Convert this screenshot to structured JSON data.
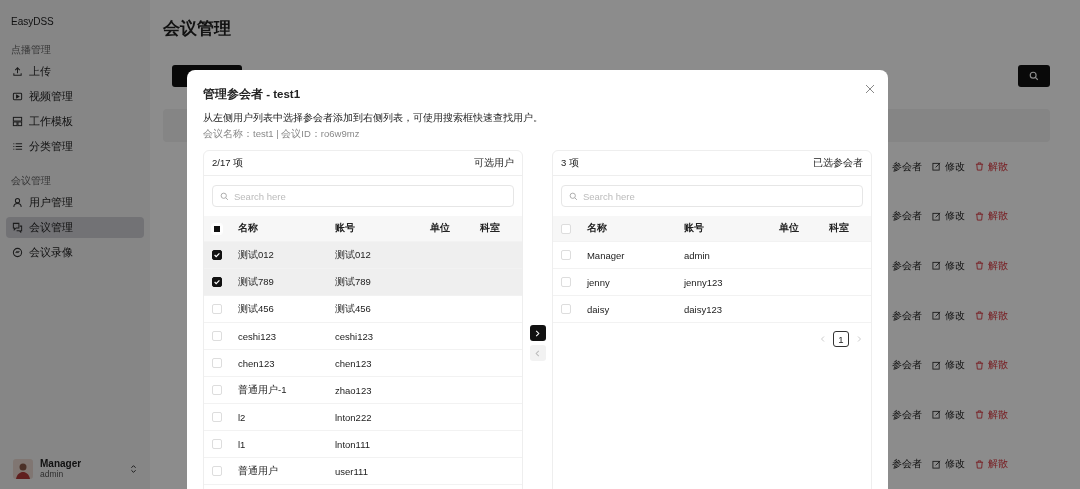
{
  "sidebar": {
    "logo": "EasyDSS",
    "sections": [
      {
        "label": "点播管理",
        "items": [
          {
            "label": "上传",
            "selected": false
          },
          {
            "label": "视频管理",
            "selected": false
          },
          {
            "label": "工作模板",
            "selected": false
          },
          {
            "label": "分类管理",
            "selected": false
          }
        ]
      },
      {
        "label": "会议管理",
        "items": [
          {
            "label": "用户管理",
            "selected": false
          },
          {
            "label": "会议管理",
            "selected": true
          },
          {
            "label": "会议录像",
            "selected": false
          }
        ]
      }
    ],
    "user": {
      "name": "Manager",
      "account": "admin"
    }
  },
  "page": {
    "title": "会议管理",
    "rows": [
      {
        "participants": "参会者",
        "edit": "修改",
        "dismiss": "解散"
      },
      {
        "participants": "参会者",
        "edit": "修改",
        "dismiss": "解散"
      },
      {
        "participants": "参会者",
        "edit": "修改",
        "dismiss": "解散"
      },
      {
        "participants": "参会者",
        "edit": "修改",
        "dismiss": "解散"
      },
      {
        "participants": "参会者",
        "edit": "修改",
        "dismiss": "解散"
      },
      {
        "participants": "参会者",
        "edit": "修改",
        "dismiss": "解散"
      },
      {
        "participants": "参会者",
        "edit": "修改",
        "dismiss": "解散"
      }
    ]
  },
  "dialog": {
    "title": "管理参会者 - test1",
    "description": "从左侧用户列表中选择参会者添加到右侧列表，可使用搜索框快速查找用户。",
    "meta": "会议名称：test1 | 会议ID：ro6w9mz",
    "panels": [
      {
        "count": "2/17 项",
        "caption": "可选用户",
        "search_placeholder": "Search here",
        "header_partial": true,
        "columns": [
          "名称",
          "账号",
          "单位",
          "科室"
        ],
        "rows": [
          {
            "name": "测试012",
            "account": "测试012",
            "checked": true
          },
          {
            "name": "测试789",
            "account": "测试789",
            "checked": true
          },
          {
            "name": "测试456",
            "account": "测试456",
            "checked": false
          },
          {
            "name": "ceshi123",
            "account": "ceshi123",
            "checked": false
          },
          {
            "name": "chen123",
            "account": "chen123",
            "checked": false
          },
          {
            "name": "普通用户-1",
            "account": "zhao123",
            "checked": false
          },
          {
            "name": "l2",
            "account": "lnton222",
            "checked": false
          },
          {
            "name": "l1",
            "account": "lnton111",
            "checked": false
          },
          {
            "name": "普通用户",
            "account": "user111",
            "checked": false
          }
        ]
      },
      {
        "count": "3 项",
        "caption": "已选参会者",
        "search_placeholder": "Search here",
        "header_partial": false,
        "columns": [
          "名称",
          "账号",
          "单位",
          "科室"
        ],
        "rows": [
          {
            "name": "Manager",
            "account": "admin",
            "checked": false
          },
          {
            "name": "jenny",
            "account": "jenny123",
            "checked": false
          },
          {
            "name": "daisy",
            "account": "daisy123",
            "checked": false
          }
        ],
        "pagination": {
          "pages": [
            {
              "label": "1",
              "selected": true
            }
          ],
          "prev_disabled": true,
          "next_disabled": true
        }
      }
    ],
    "move_right_disabled": false,
    "move_left_disabled": true
  }
}
